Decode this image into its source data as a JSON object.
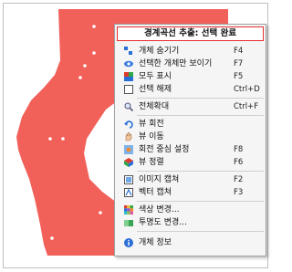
{
  "menu": {
    "title": "경계곡선 추출: 선택 완료",
    "items": [
      {
        "icon": "hide-object-icon",
        "label": "개체 숨기기",
        "shortcut": "F4"
      },
      {
        "icon": "show-selected-only-icon",
        "label": "선택한 개체만 보이기",
        "shortcut": "F7"
      },
      {
        "icon": "show-all-icon",
        "label": "모두 표시",
        "shortcut": "F5"
      },
      {
        "icon": "deselect-icon",
        "label": "선택 해제",
        "shortcut": "Ctrl+D"
      },
      {
        "icon": "zoom-all-icon",
        "label": "전체확대",
        "shortcut": "Ctrl+F"
      },
      {
        "icon": "rotate-view-icon",
        "label": "뷰 회전",
        "shortcut": ""
      },
      {
        "icon": "pan-view-icon",
        "label": "뷰 이동",
        "shortcut": ""
      },
      {
        "icon": "rotation-center-icon",
        "label": "회전 중심 설정",
        "shortcut": "F8"
      },
      {
        "icon": "align-view-icon",
        "label": "뷰 정렬",
        "shortcut": "F6"
      },
      {
        "icon": "image-capture-icon",
        "label": "이미지 캡쳐",
        "shortcut": "F2"
      },
      {
        "icon": "vector-capture-icon",
        "label": "벡터 캡쳐",
        "shortcut": "F3"
      },
      {
        "icon": "color-change-icon",
        "label": "색상 변경...",
        "shortcut": ""
      },
      {
        "icon": "transparency-change-icon",
        "label": "투명도 변경...",
        "shortcut": ""
      },
      {
        "icon": "object-info-icon",
        "label": "개체 정보",
        "shortcut": ""
      }
    ]
  },
  "colors": {
    "part": "#f2605a",
    "menu_bg": "#f5f5f5",
    "header_border": "#e8302e",
    "background": "#ffffff"
  }
}
